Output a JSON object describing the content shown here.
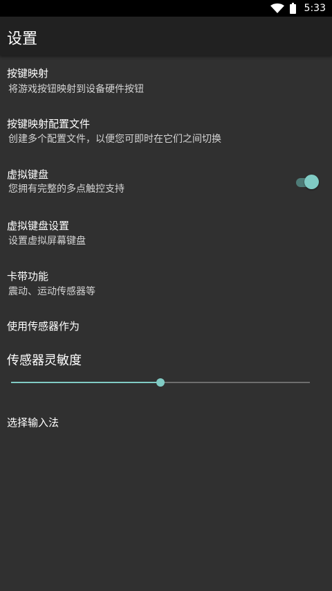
{
  "status_bar": {
    "time": "5:33",
    "wifi_icon": "wifi-icon",
    "battery_icon": "battery-icon"
  },
  "app_bar": {
    "title": "设置"
  },
  "preferences": [
    {
      "title": "按键映射",
      "summary": "将游戏按钮映射到设备硬件按钮"
    },
    {
      "title": "按键映射配置文件",
      "summary": "创建多个配置文件，以便您可即时在它们之间切换"
    },
    {
      "title": "虚拟键盘",
      "summary": "您拥有完整的多点触控支持",
      "toggle_on": true
    },
    {
      "title": "虚拟键盘设置",
      "summary": "设置虚拟屏幕键盘"
    },
    {
      "title": "卡带功能",
      "summary": "震动、运动传感器等"
    },
    {
      "title": "使用传感器作为"
    },
    {
      "title": "传感器灵敏度"
    },
    {
      "title": "选择输入法"
    }
  ],
  "sensitivity_slider": {
    "value": 0.5
  },
  "colors": {
    "accent": "#80cbc4",
    "background": "#303030",
    "appbar": "#212121"
  }
}
